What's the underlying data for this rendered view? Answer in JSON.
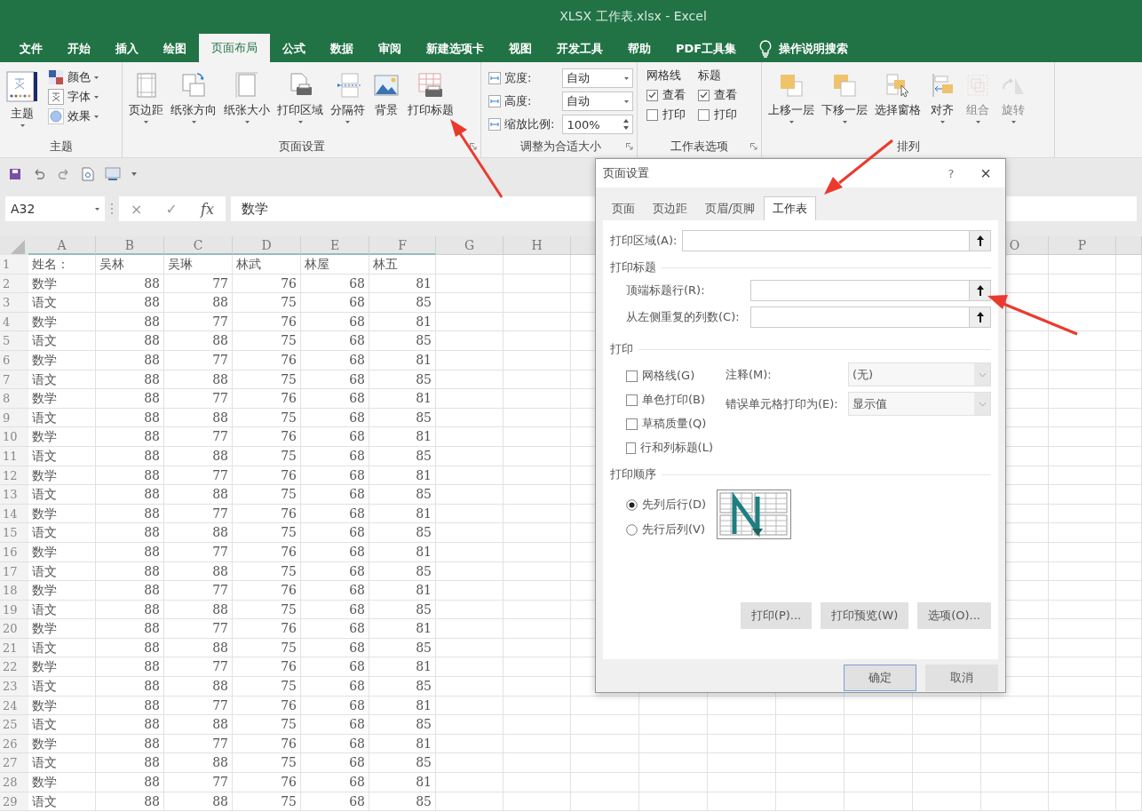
{
  "window": {
    "title": "XLSX 工作表.xlsx  -  Excel"
  },
  "ribbon_tabs": [
    {
      "label": "文件",
      "selected": false
    },
    {
      "label": "开始",
      "selected": false
    },
    {
      "label": "插入",
      "selected": false
    },
    {
      "label": "绘图",
      "selected": false
    },
    {
      "label": "页面布局",
      "selected": true
    },
    {
      "label": "公式",
      "selected": false
    },
    {
      "label": "数据",
      "selected": false
    },
    {
      "label": "审阅",
      "selected": false
    },
    {
      "label": "新建选项卡",
      "selected": false
    },
    {
      "label": "视图",
      "selected": false
    },
    {
      "label": "开发工具",
      "selected": false
    },
    {
      "label": "帮助",
      "selected": false
    },
    {
      "label": "PDF工具集",
      "selected": false
    }
  ],
  "tell_me": "操作说明搜索",
  "theme_group": {
    "label": "主题",
    "big": {
      "label": "主题",
      "dropdown": true
    },
    "small": [
      {
        "label": "颜色",
        "dropdown": true
      },
      {
        "label": "字体",
        "dropdown": true
      },
      {
        "label": "效果",
        "dropdown": true
      }
    ]
  },
  "page_setup_group": {
    "label": "页面设置",
    "buttons": [
      {
        "label": "页边距",
        "dropdown": true
      },
      {
        "label": "纸张方向",
        "dropdown": true
      },
      {
        "label": "纸张大小",
        "dropdown": true
      },
      {
        "label": "打印区域",
        "dropdown": true
      },
      {
        "label": "分隔符",
        "dropdown": true
      },
      {
        "label": "背景",
        "dropdown": false
      },
      {
        "label": "打印标题",
        "dropdown": false
      }
    ]
  },
  "scale_group": {
    "label": "调整为合适大小",
    "rows": [
      {
        "label": "宽度:",
        "value": "自动",
        "kind": "dropdown"
      },
      {
        "label": "高度:",
        "value": "自动",
        "kind": "dropdown"
      },
      {
        "label": "缩放比例:",
        "value": "100%",
        "kind": "spinner"
      }
    ]
  },
  "sheet_options_group": {
    "label": "工作表选项",
    "columns": [
      {
        "title": "网格线",
        "options": [
          {
            "label": "查看",
            "checked": true
          },
          {
            "label": "打印",
            "checked": false
          }
        ]
      },
      {
        "title": "标题",
        "options": [
          {
            "label": "查看",
            "checked": true
          },
          {
            "label": "打印",
            "checked": false
          }
        ]
      }
    ]
  },
  "arrange_group": {
    "label": "排列",
    "buttons": [
      {
        "label": "上移一层",
        "dropdown": true,
        "disabled": false
      },
      {
        "label": "下移一层",
        "dropdown": true,
        "disabled": false
      },
      {
        "label": "选择窗格",
        "dropdown": false,
        "disabled": false
      },
      {
        "label": "对齐",
        "dropdown": true,
        "disabled": false
      },
      {
        "label": "组合",
        "dropdown": true,
        "disabled": true
      },
      {
        "label": "旋转",
        "dropdown": true,
        "disabled": true
      }
    ]
  },
  "formula_bar": {
    "name_box": "A32",
    "cancel": "×",
    "enter": "✓",
    "fx": "fx",
    "value": "数学"
  },
  "sheet": {
    "columns": [
      "A",
      "B",
      "C",
      "D",
      "E",
      "F",
      "G",
      "H"
    ],
    "right_columns": [
      "O",
      "P"
    ],
    "rows": [
      {
        "number": "1",
        "kind": "names",
        "cells": [
          "姓名：",
          "吴林",
          "吴琳",
          "林武",
          "林屋",
          "林五"
        ]
      },
      {
        "number": "2",
        "kind": "scores",
        "cells": [
          "数学",
          "88",
          "77",
          "76",
          "68",
          "81"
        ]
      },
      {
        "number": "3",
        "kind": "scores",
        "cells": [
          "语文",
          "88",
          "88",
          "75",
          "68",
          "85"
        ]
      },
      {
        "number": "4",
        "kind": "scores",
        "cells": [
          "数学",
          "88",
          "77",
          "76",
          "68",
          "81"
        ]
      },
      {
        "number": "5",
        "kind": "scores",
        "cells": [
          "语文",
          "88",
          "88",
          "75",
          "68",
          "85"
        ]
      },
      {
        "number": "6",
        "kind": "scores",
        "cells": [
          "数学",
          "88",
          "77",
          "76",
          "68",
          "81"
        ]
      },
      {
        "number": "7",
        "kind": "scores",
        "cells": [
          "语文",
          "88",
          "88",
          "75",
          "68",
          "85"
        ]
      },
      {
        "number": "8",
        "kind": "scores",
        "cells": [
          "数学",
          "88",
          "77",
          "76",
          "68",
          "81"
        ]
      },
      {
        "number": "9",
        "kind": "scores",
        "cells": [
          "语文",
          "88",
          "88",
          "75",
          "68",
          "85"
        ]
      },
      {
        "number": "10",
        "kind": "scores",
        "cells": [
          "数学",
          "88",
          "77",
          "76",
          "68",
          "81"
        ]
      },
      {
        "number": "11",
        "kind": "scores",
        "cells": [
          "语文",
          "88",
          "88",
          "75",
          "68",
          "85"
        ]
      },
      {
        "number": "12",
        "kind": "scores",
        "cells": [
          "数学",
          "88",
          "77",
          "76",
          "68",
          "81"
        ]
      },
      {
        "number": "13",
        "kind": "scores",
        "cells": [
          "语文",
          "88",
          "88",
          "75",
          "68",
          "85"
        ]
      },
      {
        "number": "14",
        "kind": "scores",
        "cells": [
          "数学",
          "88",
          "77",
          "76",
          "68",
          "81"
        ]
      },
      {
        "number": "15",
        "kind": "scores",
        "cells": [
          "语文",
          "88",
          "88",
          "75",
          "68",
          "85"
        ]
      },
      {
        "number": "16",
        "kind": "scores",
        "cells": [
          "数学",
          "88",
          "77",
          "76",
          "68",
          "81"
        ]
      },
      {
        "number": "17",
        "kind": "scores",
        "cells": [
          "语文",
          "88",
          "88",
          "75",
          "68",
          "85"
        ]
      },
      {
        "number": "18",
        "kind": "scores",
        "cells": [
          "数学",
          "88",
          "77",
          "76",
          "68",
          "81"
        ]
      },
      {
        "number": "19",
        "kind": "scores",
        "cells": [
          "语文",
          "88",
          "88",
          "75",
          "68",
          "85"
        ]
      },
      {
        "number": "20",
        "kind": "scores",
        "cells": [
          "数学",
          "88",
          "77",
          "76",
          "68",
          "81"
        ]
      },
      {
        "number": "21",
        "kind": "scores",
        "cells": [
          "语文",
          "88",
          "88",
          "75",
          "68",
          "85"
        ]
      },
      {
        "number": "22",
        "kind": "scores",
        "cells": [
          "数学",
          "88",
          "77",
          "76",
          "68",
          "81"
        ]
      },
      {
        "number": "23",
        "kind": "scores",
        "cells": [
          "语文",
          "88",
          "88",
          "75",
          "68",
          "85"
        ]
      },
      {
        "number": "24",
        "kind": "scores",
        "cells": [
          "数学",
          "88",
          "77",
          "76",
          "68",
          "81"
        ]
      },
      {
        "number": "25",
        "kind": "scores",
        "cells": [
          "语文",
          "88",
          "88",
          "75",
          "68",
          "85"
        ]
      },
      {
        "number": "26",
        "kind": "scores",
        "cells": [
          "数学",
          "88",
          "77",
          "76",
          "68",
          "81"
        ]
      },
      {
        "number": "27",
        "kind": "scores",
        "cells": [
          "语文",
          "88",
          "88",
          "75",
          "68",
          "85"
        ]
      },
      {
        "number": "28",
        "kind": "scores",
        "cells": [
          "数学",
          "88",
          "77",
          "76",
          "68",
          "81"
        ]
      },
      {
        "number": "29",
        "kind": "scores",
        "cells": [
          "语文",
          "88",
          "88",
          "75",
          "68",
          "85"
        ]
      }
    ]
  },
  "dialog": {
    "title": "页面设置",
    "help": "?",
    "close": "×",
    "tabs": [
      {
        "label": "页面",
        "selected": false
      },
      {
        "label": "页边距",
        "selected": false
      },
      {
        "label": "页眉/页脚",
        "selected": false
      },
      {
        "label": "工作表",
        "selected": true
      }
    ],
    "print_area_label": "打印区域(A):",
    "print_titles": {
      "title": "打印标题",
      "fields": [
        {
          "label": "顶端标题行(R):"
        },
        {
          "label": "从左侧重复的列数(C):"
        }
      ]
    },
    "print": {
      "title": "打印",
      "checkboxes": [
        {
          "label": "网格线(G)",
          "checked": false
        },
        {
          "label": "单色打印(B)",
          "checked": false
        },
        {
          "label": "草稿质量(Q)",
          "checked": false
        },
        {
          "label": "行和列标题(L)",
          "checked": false
        }
      ],
      "selects": [
        {
          "label": "注释(M):",
          "value": "(无)"
        },
        {
          "label": "错误单元格打印为(E):",
          "value": "显示值"
        }
      ]
    },
    "page_order": {
      "title": "打印顺序",
      "options": [
        {
          "label": "先列后行(D)",
          "selected": true
        },
        {
          "label": "先行后列(V)",
          "selected": false
        }
      ]
    },
    "action_buttons": [
      "打印(P)...",
      "打印预览(W)",
      "选项(O)..."
    ],
    "ok": "确定",
    "cancel": "取消"
  }
}
